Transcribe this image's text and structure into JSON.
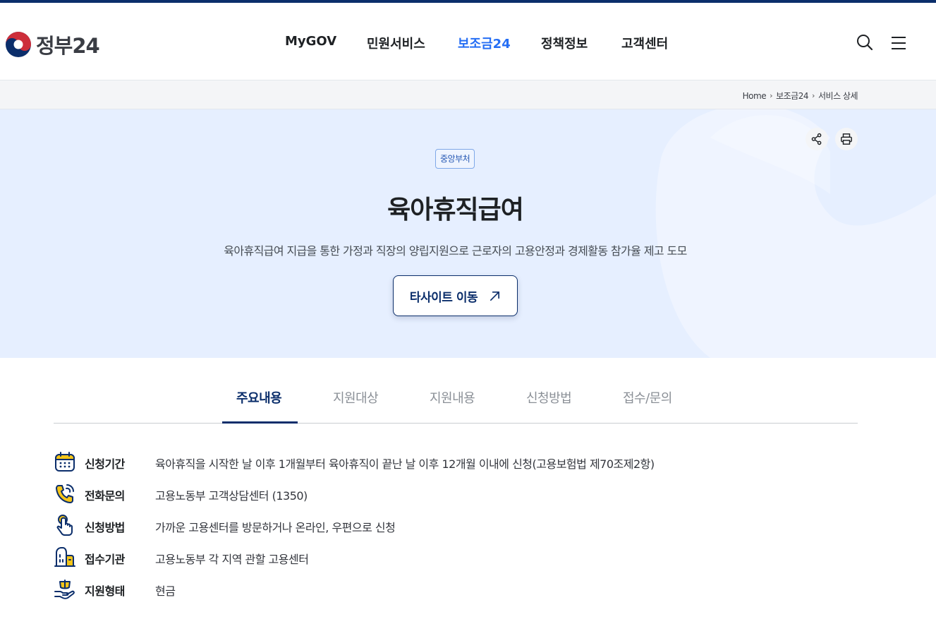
{
  "header": {
    "brand": "정부24",
    "nav": [
      {
        "label": "MyGOV",
        "active": false
      },
      {
        "label": "민원서비스",
        "active": false
      },
      {
        "label": "보조금24",
        "active": true
      },
      {
        "label": "정책정보",
        "active": false
      },
      {
        "label": "고객센터",
        "active": false
      }
    ],
    "icons": [
      "search-icon",
      "menu-icon"
    ]
  },
  "breadcrumb": [
    "Home",
    "보조금24",
    "서비스 상세"
  ],
  "hero": {
    "badge": "중앙부처",
    "title": "육아휴직급여",
    "description": "육아휴직급여 지급을 통한 가정과 직장의 양립지원으로 근로자의 고용안정과 경제활동 참가율 제고 도모",
    "button_label": "타사이트 이동",
    "actions": [
      "share-icon",
      "print-icon"
    ]
  },
  "tabs": [
    {
      "label": "주요내용",
      "active": true
    },
    {
      "label": "지원대상",
      "active": false
    },
    {
      "label": "지원내용",
      "active": false
    },
    {
      "label": "신청방법",
      "active": false
    },
    {
      "label": "접수/문의",
      "active": false
    }
  ],
  "summary": [
    {
      "icon": "calendar-icon",
      "label": "신청기간",
      "value": "육아휴직을 시작한 날 이후 1개월부터 육아휴직이 끝난 날 이후 12개월 이내에 신청(고용보험법 제70조제2항)"
    },
    {
      "icon": "phone-icon",
      "label": "전화문의",
      "value": "고용노동부 고객상담센터 (1350)"
    },
    {
      "icon": "tap-hand-icon",
      "label": "신청방법",
      "value": "가까운 고용센터를 방문하거나 온라인, 우편으로 신청"
    },
    {
      "icon": "building-icon",
      "label": "접수기관",
      "value": "고용노동부 각 지역 관할 고용센터"
    },
    {
      "icon": "money-hand-icon",
      "label": "지원형태",
      "value": "현금"
    }
  ],
  "colors": {
    "navy": "#0b2e6b",
    "active_nav": "#256ef4",
    "hero_bg": "#e6efff",
    "icon_yellow": "#f5c518"
  }
}
